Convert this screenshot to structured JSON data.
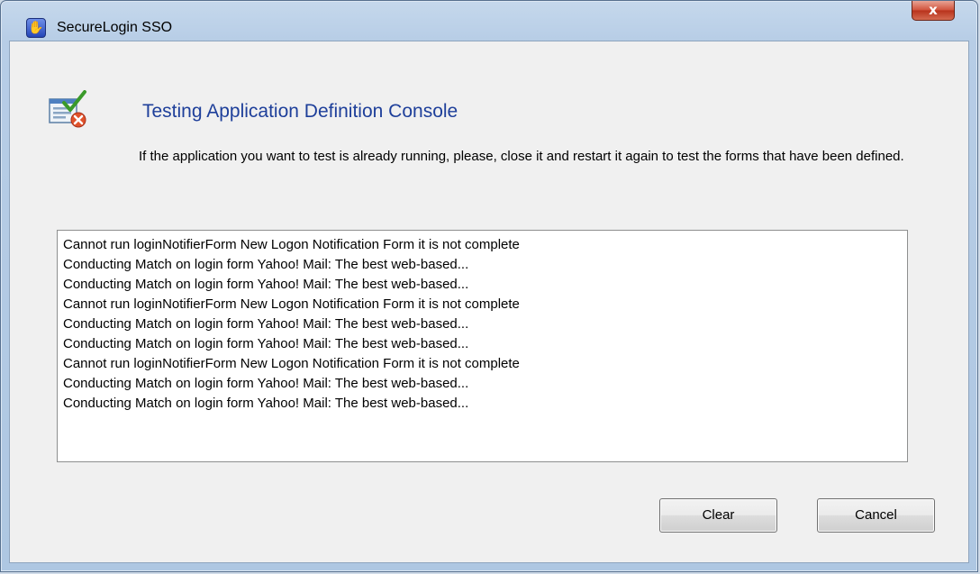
{
  "window": {
    "title": "SecureLogin SSO",
    "close_label": "x"
  },
  "header": {
    "title": "Testing Application Definition Console",
    "instructions": "If the application you want to test is already running, please, close it and restart it again to test the forms that have been defined."
  },
  "log": {
    "lines": [
      "Cannot run loginNotifierForm New Logon Notification Form it is not complete",
      "Conducting Match on login form Yahoo! Mail: The best web-based...",
      "Conducting Match on login form Yahoo! Mail: The best web-based...",
      "Cannot run loginNotifierForm New Logon Notification Form it is not complete",
      "Conducting Match on login form Yahoo! Mail: The best web-based...",
      "Conducting Match on login form Yahoo! Mail: The best web-based...",
      "Cannot run loginNotifierForm New Logon Notification Form it is not complete",
      "Conducting Match on login form Yahoo! Mail: The best web-based...",
      "Conducting Match on login form Yahoo! Mail: The best web-based..."
    ]
  },
  "buttons": {
    "clear": "Clear",
    "cancel": "Cancel"
  },
  "icons": {
    "app": "securelogin-hand-icon",
    "header": "form-test-checkmark-icon",
    "close": "close-icon"
  },
  "colors": {
    "heading": "#1e3f9a",
    "close_button": "#c9402a",
    "frame": "#b7cde6"
  }
}
